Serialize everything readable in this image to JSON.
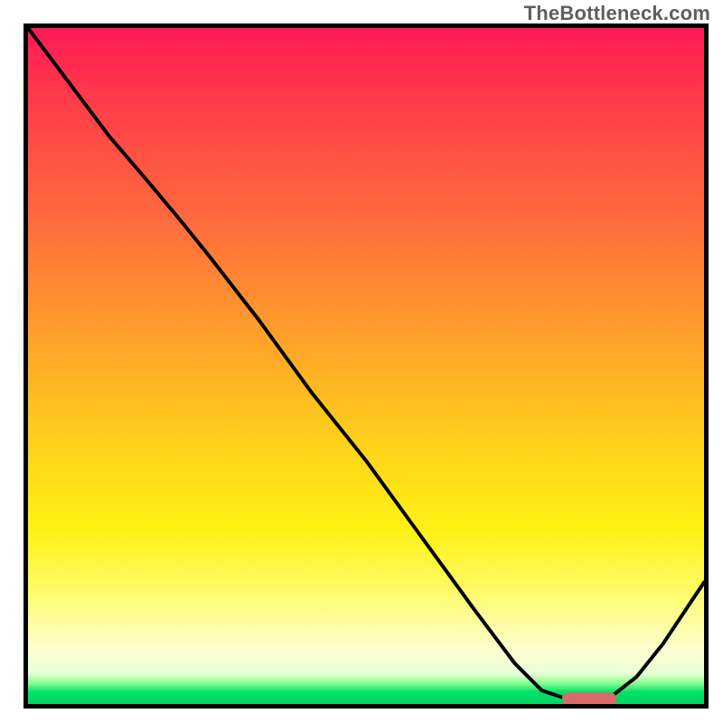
{
  "watermark": "TheBottleneck.com",
  "colors": {
    "border": "#000000",
    "curve": "#000000",
    "marker": "#d96a6a",
    "gradient_top": "#ff1a55",
    "gradient_mid": "#ffd819",
    "gradient_bottom": "#00d463"
  },
  "chart_data": {
    "type": "line",
    "title": "",
    "xlabel": "",
    "ylabel": "",
    "xlim": [
      0,
      100
    ],
    "ylim": [
      0,
      100
    ],
    "grid": false,
    "legend": false,
    "note": "No axes or tick labels are visible; x/y are normalized 0–100. y represents distance from the optimal (bottom) — lower is better (green). The curve descends from top-left, flattens at the bottom around x≈78–86, then rises toward the right edge.",
    "series": [
      {
        "name": "bottleneck-curve",
        "x": [
          0,
          6,
          12,
          18,
          23,
          27,
          34,
          42,
          50,
          58,
          66,
          72,
          76,
          79,
          82,
          86,
          90,
          94,
          98,
          100
        ],
        "y": [
          100,
          92,
          84,
          77,
          71,
          66,
          57,
          46,
          36,
          25,
          14,
          6,
          2,
          1,
          0.8,
          0.9,
          4,
          9,
          15,
          18
        ]
      }
    ],
    "marker": {
      "name": "optimal-range",
      "x_start": 79,
      "x_end": 87,
      "y": 0.8
    }
  }
}
